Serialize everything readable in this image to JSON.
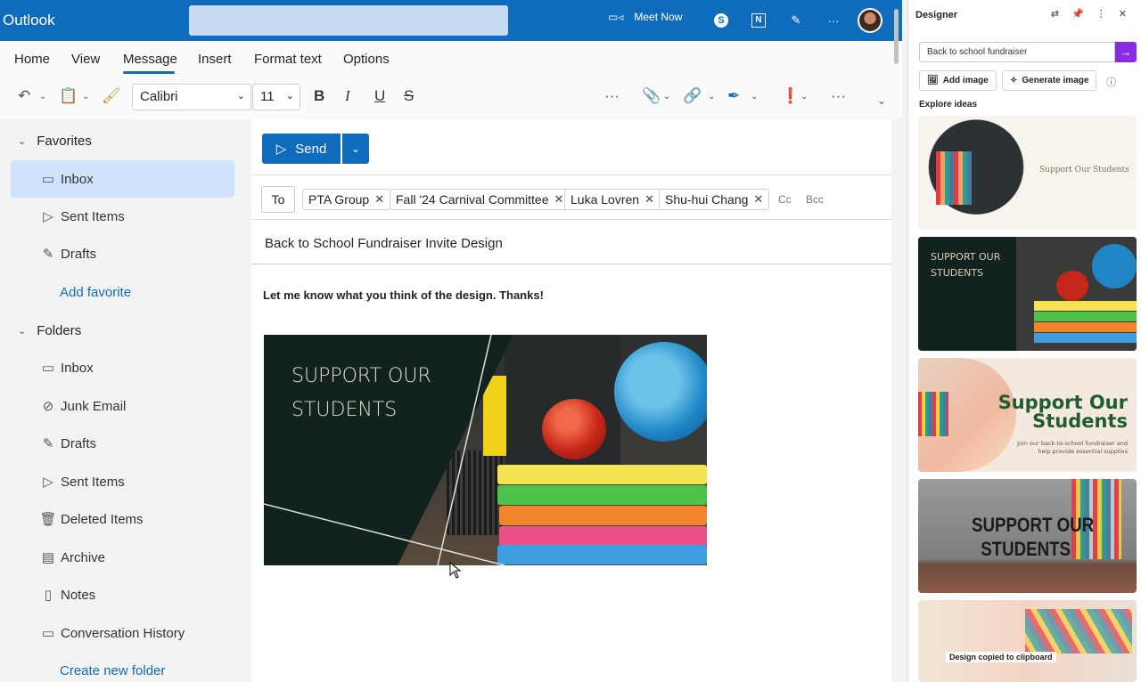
{
  "app": {
    "title": "Outlook",
    "meet_now": "Meet Now"
  },
  "ribbon": {
    "tabs": [
      "Home",
      "View",
      "Message",
      "Insert",
      "Format text",
      "Options"
    ],
    "active_tab": "Message",
    "font_name": "Calibri",
    "font_size": "11"
  },
  "sidebar": {
    "favorites_label": "Favorites",
    "favorites": [
      {
        "label": "Inbox",
        "icon": "inbox-icon"
      },
      {
        "label": "Sent Items",
        "icon": "send-icon"
      },
      {
        "label": "Drafts",
        "icon": "pencil-icon"
      }
    ],
    "add_favorite": "Add favorite",
    "folders_label": "Folders",
    "folders": [
      {
        "label": "Inbox",
        "icon": "inbox-icon"
      },
      {
        "label": "Junk Email",
        "icon": "junk-icon"
      },
      {
        "label": "Drafts",
        "icon": "pencil-icon"
      },
      {
        "label": "Sent Items",
        "icon": "send-icon"
      },
      {
        "label": "Deleted Items",
        "icon": "trash-icon"
      },
      {
        "label": "Archive",
        "icon": "archive-icon"
      },
      {
        "label": "Notes",
        "icon": "note-icon"
      },
      {
        "label": "Conversation History",
        "icon": "folder-icon"
      }
    ],
    "create_folder": "Create new folder"
  },
  "compose": {
    "send_label": "Send",
    "to_label": "To",
    "recipients": [
      "PTA Group",
      "Fall '24 Carnival Committee",
      "Luka Lovren",
      "Shu-hui Chang"
    ],
    "cc": "Cc",
    "bcc": "Bcc",
    "subject": "Back to School Fundraiser Invite Design",
    "body": "Let me know what you think of the design. Thanks!",
    "image_title_line1": "SUPPORT OUR",
    "image_title_line2": "STUDENTS"
  },
  "designer": {
    "title": "Designer",
    "prompt": "Back to school fundraiser",
    "add_image": "Add image",
    "generate_image": "Generate image",
    "explore": "Explore ideas",
    "card1_text": "Support Our Students",
    "card2_line1": "SUPPORT OUR",
    "card2_line2": "STUDENTS",
    "card3_line1": "Support Our",
    "card3_line2": "Students",
    "card3_sub": "Join our back-to-school fundraiser and help provide essential supplies",
    "card4_line1": "SUPPORT OUR",
    "card4_line2": "STUDENTS",
    "toast": "Design copied to clipboard"
  },
  "colors": {
    "brand": "#0f6cbd",
    "designer_accent": "#8a2be2"
  }
}
